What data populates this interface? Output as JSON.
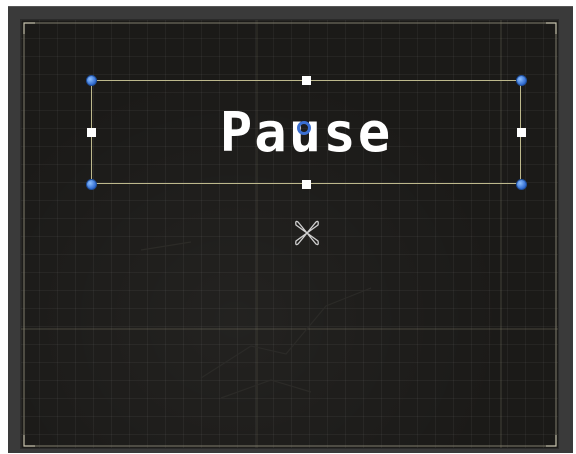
{
  "label": {
    "text": "Pause"
  },
  "colors": {
    "frame": "#3a3a3a",
    "canvas": "#1b1a18",
    "selection_outline": "#bdb88c",
    "handle_corner": "#3b6fd1",
    "handle_edge": "#ffffff",
    "pivot": "#3b6fd1",
    "label_text": "#ffffff"
  },
  "icons": {
    "pivot": "pivot-circle-icon",
    "anchor": "anchor-flower-icon",
    "corner_handle": "blue-dot-icon",
    "edge_handle": "white-square-icon"
  }
}
